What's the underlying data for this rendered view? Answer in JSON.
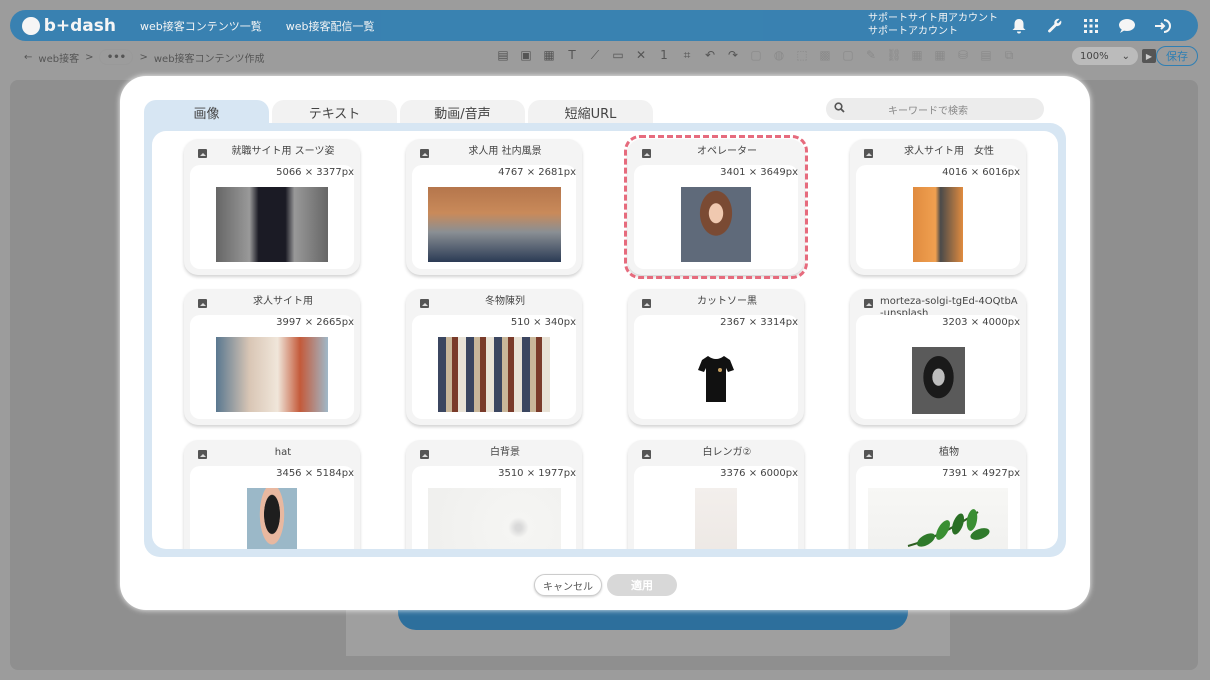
{
  "app": {
    "brand": "b+dash",
    "nav": [
      "web接客コンテンツ一覧",
      "web接客配信一覧"
    ],
    "support": [
      "サポートサイト用アカウント",
      "サポートアカウント"
    ],
    "icons": [
      "bell-icon",
      "wrench-icon",
      "apps-icon",
      "chat-icon",
      "logout-icon"
    ]
  },
  "subbar": {
    "back": "←",
    "crumb1": "web接客",
    "sep": ">",
    "dots": "•••",
    "crumb2": "web接客コンテンツ作成",
    "zoom": "100%",
    "zoom_caret": "⌄",
    "save": "保存",
    "tool_glyphs": [
      "▤",
      "▣",
      "▦",
      "T",
      "⟋",
      "▭",
      "✕",
      "1",
      "⌗",
      "↶",
      "↷",
      "▢",
      "◍",
      "⬚",
      "▩",
      "▢",
      "✎",
      "⛓",
      "▦",
      "▦",
      "⛁",
      "▤",
      "⧉"
    ]
  },
  "modal": {
    "tabs": [
      "画像",
      "テキスト",
      "動画/音声",
      "短縮URL"
    ],
    "active_tab": 0,
    "search_placeholder": "キーワードで検索",
    "cancel": "キャンセル",
    "apply": "適用"
  },
  "images": [
    {
      "title": "就職サイト用 スーツ姿",
      "size": "5066 × 3377px",
      "theme": "suit"
    },
    {
      "title": "求人用 社内風景",
      "size": "4767 × 2681px",
      "theme": "office"
    },
    {
      "title": "オペレーター",
      "size": "3401 × 3649px",
      "theme": "operator",
      "selected": true
    },
    {
      "title": "求人サイト用　女性",
      "size": "4016 × 6016px",
      "theme": "woman"
    },
    {
      "title": "求人サイト用",
      "size": "3997 × 2665px",
      "theme": "meeting"
    },
    {
      "title": "冬物陳列",
      "size": "510 × 340px",
      "theme": "clothes"
    },
    {
      "title": "カットソー黒",
      "size": "2367 × 3314px",
      "theme": "tshirt"
    },
    {
      "title": "morteza-solgi-tgEd-4OQtbA-unsplash",
      "size": "3203 × 4000px",
      "theme": "bw"
    },
    {
      "title": "hat",
      "size": "3456 × 5184px",
      "theme": "hat"
    },
    {
      "title": "白背景",
      "size": "3510 × 1977px",
      "theme": "white"
    },
    {
      "title": "白レンガ②",
      "size": "3376 × 6000px",
      "theme": "brick"
    },
    {
      "title": "植物",
      "size": "7391 × 4927px",
      "theme": "plant"
    }
  ]
}
